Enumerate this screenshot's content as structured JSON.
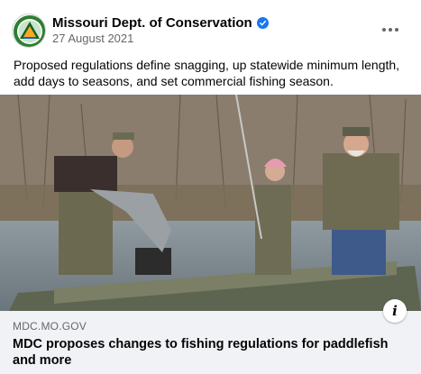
{
  "post": {
    "page_name": "Missouri Dept. of Conservation",
    "date": "27 August 2021",
    "text": "Proposed regulations define snagging, up statewide minimum length, add days to seasons, and set commercial fishing season."
  },
  "link": {
    "domain": "MDC.MO.GOV",
    "title": "MDC proposes changes to fishing regulations for paddlefish and more"
  },
  "icons": {
    "avatar": "mdc-logo-icon",
    "verified": "verified-badge-icon",
    "more": "more-options-icon",
    "info": "info-icon"
  },
  "colors": {
    "verified": "#1877f2",
    "secondary_text": "#65676b",
    "link_box_bg": "#f0f2f5"
  }
}
